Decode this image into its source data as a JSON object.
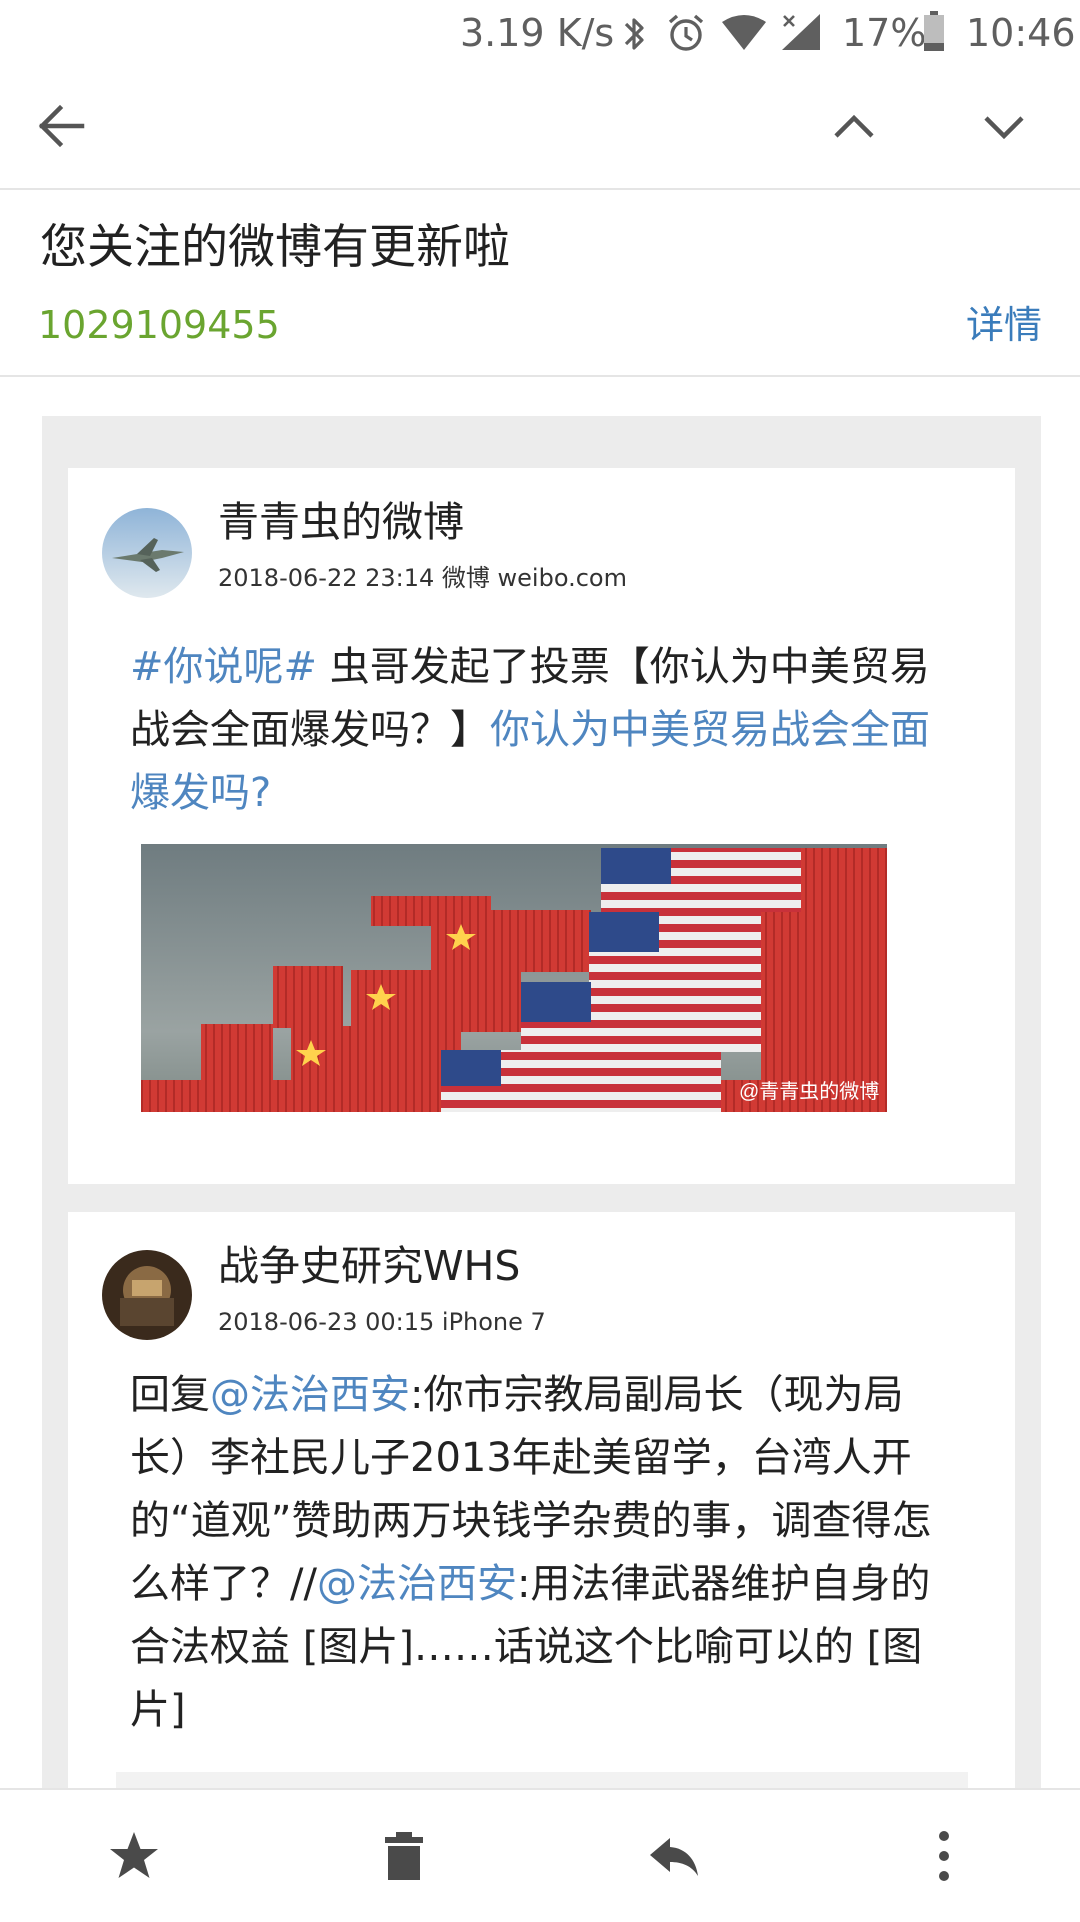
{
  "status_bar": {
    "speed": "3.19 K/s",
    "battery": "17%",
    "time": "10:46"
  },
  "toolbar": {
    "back_icon": "arrow-left-icon",
    "prev_icon": "chevron-up-icon",
    "next_icon": "chevron-down-icon"
  },
  "header": {
    "subject": "您关注的微博有更新啦",
    "sender": "1029109455",
    "details_label": "详情"
  },
  "posts": [
    {
      "author": "青青虫的微博",
      "meta": "2018-06-22 23:14 微博 weibo.com",
      "text_link1": "#你说呢#",
      "text_plain": " 虫哥发起了投票【你认为中美贸易战会全面爆发吗？】",
      "text_link2": "你认为中美贸易战会全面爆发吗?",
      "image_watermark": "@青青虫的微博"
    },
    {
      "author": "战争史研究WHS",
      "meta": "2018-06-23 00:15 iPhone 7",
      "text_p1": "回复",
      "text_link1": "@法治西安",
      "text_p2": ":你市宗教局副局长（现为局长）李社民儿子2013年赴美留学，台湾人开的“道观”赞助两万块钱学杂费的事，调查得怎么样了？//",
      "text_link2": "@法治西安",
      "text_p3": ":用法律武器维护自身的合法权益 [图片]……话说这个比喻可以的 [图片]"
    }
  ],
  "bottom_bar": {
    "star_icon": "star-icon",
    "delete_icon": "trash-icon",
    "reply_icon": "reply-icon",
    "more_icon": "more-vert-icon"
  },
  "colors": {
    "sender_green": "#6aa530",
    "link_blue": "#4f86c0",
    "details_blue": "#3a7cbb",
    "body_bg": "#ececec"
  }
}
